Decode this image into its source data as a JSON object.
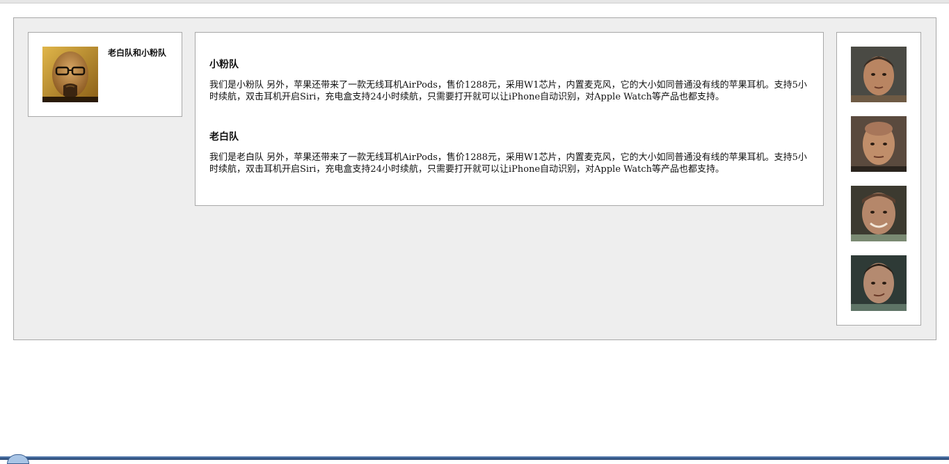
{
  "profile": {
    "title": "老白队和小粉队",
    "avatar_icon": "bald-man-glasses-goatee-avatar"
  },
  "articles": [
    {
      "heading": "小粉队",
      "body": "我们是小粉队 另外，苹果还带来了一款无线耳机AirPods，售价1288元，采用W1芯片，内置麦克风，它的大小如同普通没有线的苹果耳机。支持5小时续航，双击耳机开启Siri，充电盒支持24小时续航，只需要打开就可以让iPhone自动识别，对Apple Watch等产品也都支持。"
    },
    {
      "heading": "老白队",
      "body": "我们是老白队 另外，苹果还带来了一款无线耳机AirPods，售价1288元，采用W1芯片，内置麦克风，它的大小如同普通没有线的苹果耳机。支持5小时续航，双击耳机开启Siri，充电盒支持24小时续航，只需要打开就可以让iPhone自动识别，对Apple Watch等产品也都支持。"
    }
  ],
  "thumbnails": [
    {
      "icon": "short-hair-man-portrait"
    },
    {
      "icon": "bald-man-portrait"
    },
    {
      "icon": "smiling-man-portrait"
    },
    {
      "icon": "slick-hair-man-portrait"
    }
  ],
  "colors": {
    "panel_background": "#eeeeee",
    "border": "#a8a8a8",
    "text": "#111111"
  }
}
